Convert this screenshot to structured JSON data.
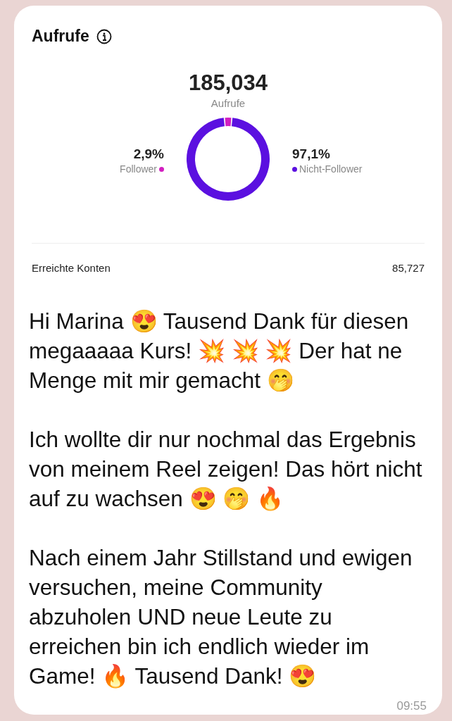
{
  "insights": {
    "title": "Aufrufe",
    "total": "185,034",
    "total_label": "Aufrufe",
    "legend": [
      {
        "percent": "2,9%",
        "color": "#d21fc0"
      },
      {
        "percent": "97,1%",
        "color": "#5b10e0"
      }
    ],
    "chart_data": {
      "type": "donut",
      "categories": [
        "Follower",
        "Nicht-Follower"
      ],
      "values": [
        2.9,
        97.1
      ]
    },
    "metric_label": "Erreichte Konten",
    "metric_value": "85,727"
  },
  "message": {
    "paragraphs": [
      "Hi Marina 😍 Tausend Dank für diesen megaaaaa Kurs! 💥 💥 💥 Der hat ne Menge mit mir gemacht 🤭",
      "Ich wollte dir nur nochmal das Ergebnis von meinem Reel zeigen! Das hört nicht auf zu wachsen 😍 🤭 🔥",
      "Nach einem Jahr Stillstand und ewigen versuchen, meine Community abzuholen UND neue Leute zu erreichen bin ich endlich wieder im Game! 🔥 Tausend Dank! 😍"
    ],
    "time": "09:55"
  }
}
